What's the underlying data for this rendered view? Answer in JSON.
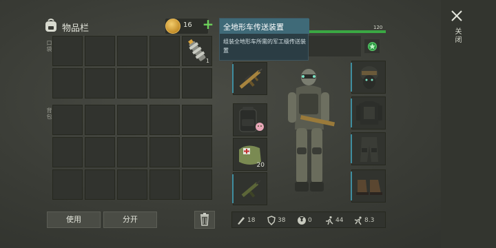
{
  "inventory": {
    "title": "物品栏",
    "coins": "16",
    "pocket_label": "口袋",
    "backpack_label": "背包",
    "pocket_item_qty": "1"
  },
  "buttons": {
    "use": "使用",
    "split": "分开"
  },
  "tooltip": {
    "title": "全地形车传送装置",
    "description": "组装全地形车所需的军工级传送装置"
  },
  "player": {
    "xp": "120"
  },
  "slots": {
    "consumable_qty": "20"
  },
  "stats": {
    "attack": "18",
    "armor": "38",
    "radiation": "0",
    "speed": "44",
    "stealth": "8.3"
  },
  "close_label": "关闭",
  "colors": {
    "accent_green": "#3aa843",
    "tooltip_header": "#3f6a78",
    "slot_accent": "#3f8ea0"
  }
}
